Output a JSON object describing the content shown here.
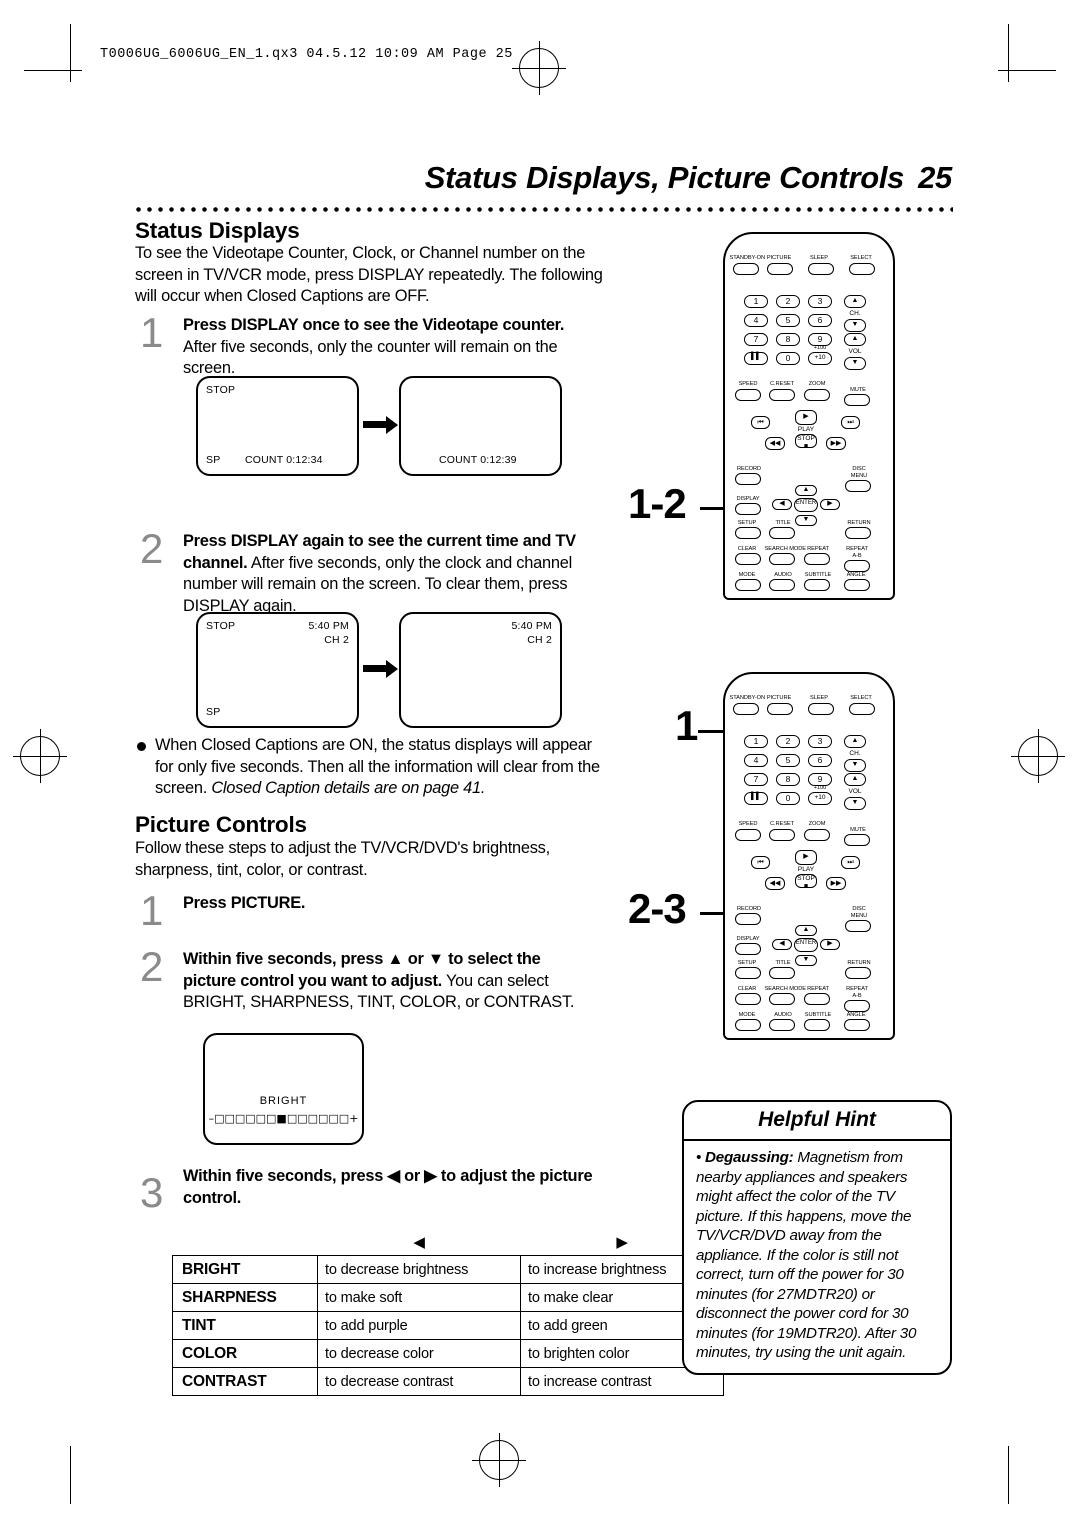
{
  "printer": {
    "slug": "T0006UG_6006UG_EN_1.qx3  04.5.12  10:09 AM  Page 25"
  },
  "header": {
    "title": "Status Displays, Picture Controls",
    "page_number": "25"
  },
  "sections": {
    "status_displays": {
      "heading": "Status Displays",
      "intro": "To see the Videotape Counter, Clock, or Channel number on the screen in TV/VCR mode, press DISPLAY repeatedly. The following will occur when Closed Captions are OFF.",
      "steps": [
        {
          "number": "1",
          "bold": "Press DISPLAY once to see the Videotape counter.",
          "rest": " After five seconds, only the counter will remain on the screen."
        },
        {
          "number": "2",
          "bold": "Press DISPLAY again to see the current time and TV channel.",
          "rest": " After five seconds, only the clock and channel number will remain on the screen. To clear them, press DISPLAY again."
        }
      ],
      "screens_1": [
        {
          "top_left": "STOP",
          "bottom_left": "SP",
          "counter": "COUNT 0:12:34"
        },
        {
          "top_left": "",
          "bottom_left": "",
          "counter": "COUNT 0:12:39"
        }
      ],
      "screens_2": [
        {
          "top_left": "STOP",
          "time": "5:40 PM",
          "channel": "CH 2",
          "bottom_left": "SP"
        },
        {
          "top_left": "",
          "time": "5:40 PM",
          "channel": "CH 2",
          "bottom_left": ""
        }
      ],
      "note": {
        "plain_1": "When Closed Captions are ON, the status displays will appear for only five seconds. Then all the information will clear from the screen. ",
        "italic": "Closed Caption details are on page 41."
      }
    },
    "picture_controls": {
      "heading": "Picture Controls",
      "intro": "Follow these steps to adjust the TV/VCR/DVD's brightness, sharpness, tint, color, or contrast.",
      "steps": [
        {
          "number": "1",
          "bold": "Press PICTURE.",
          "rest": ""
        },
        {
          "number": "2",
          "bold": "Within five seconds, press ▲ or ▼ to select the picture control you want to adjust.",
          "rest": " You can select BRIGHT, SHARPNESS, TINT, COLOR, or CONTRAST."
        },
        {
          "number": "3",
          "bold": "Within five seconds, press ◀ or ▶ to adjust the picture control.",
          "rest": ""
        }
      ],
      "bright_screen": {
        "label": "BRIGHT",
        "bar": "–□□□□□□■□□□□□□+"
      },
      "table": {
        "col_head_left": "◀",
        "col_head_right": "▶",
        "rows": [
          {
            "name": "BRIGHT",
            "left": "to decrease brightness",
            "right": "to increase brightness"
          },
          {
            "name": "SHARPNESS",
            "left": "to make soft",
            "right": "to make clear"
          },
          {
            "name": "TINT",
            "left": "to add purple",
            "right": "to add green"
          },
          {
            "name": "COLOR",
            "left": "to decrease color",
            "right": "to brighten color"
          },
          {
            "name": "CONTRAST",
            "left": "to decrease contrast",
            "right": "to increase contrast"
          }
        ]
      }
    }
  },
  "helpful_hint": {
    "title": "Helpful Hint",
    "term": "Degaussing:",
    "body": " Magnetism from nearby appliances and speakers might affect the color of the TV picture. If this happens, move the TV/VCR/DVD away from the appliance. If the color is still not correct, turn off the power for 30 minutes (for 27MDTR20) or disconnect the power cord for 30 minutes (for 19MDTR20). After 30 minutes, try using the unit again."
  },
  "callouts": {
    "top": "1-2",
    "middle": "1",
    "bottom": "2-3"
  },
  "remote": {
    "top_row": [
      "STANDBY-ON",
      "PICTURE",
      "SLEEP",
      "SELECT"
    ],
    "numbers": [
      "1",
      "2",
      "3",
      "4",
      "5",
      "6",
      "7",
      "8",
      "9",
      "0"
    ],
    "side_labels": {
      "ch": "CH.",
      "vol": "VOL"
    },
    "num_extra": [
      "+100",
      "+10"
    ],
    "pause_glyph": "▐▐",
    "row_speed": [
      "SPEED",
      "C.RESET",
      "ZOOM",
      "MUTE"
    ],
    "transport": {
      "play": "PLAY",
      "stop": "STOP",
      "prev": "⏮",
      "next": "⏭",
      "rew": "◀◀",
      "ff": "▶▶",
      "play_glyph": "▶",
      "stop_glyph": "■"
    },
    "rows": [
      [
        "RECORD",
        "DISC MENU"
      ],
      [
        "DISPLAY",
        "ENTER"
      ],
      [
        "SETUP",
        "TITLE",
        "RETURN"
      ],
      [
        "CLEAR",
        "SEARCH MODE",
        "REPEAT",
        "REPEAT A-B"
      ],
      [
        "MODE",
        "AUDIO",
        "SUBTITLE",
        "ANGLE"
      ]
    ],
    "labels": {
      "record": "RECORD",
      "disc_menu_1": "DISC",
      "disc_menu_2": "MENU",
      "display": "DISPLAY",
      "enter": "ENTER",
      "setup": "SETUP",
      "title": "TITLE",
      "return": "RETURN",
      "clear": "CLEAR",
      "search_mode": "SEARCH MODE",
      "repeat": "REPEAT",
      "repeat2": "REPEAT",
      "ab": "A-B",
      "mode": "MODE",
      "audio": "AUDIO",
      "subtitle": "SUBTITLE",
      "angle": "ANGLE"
    }
  }
}
